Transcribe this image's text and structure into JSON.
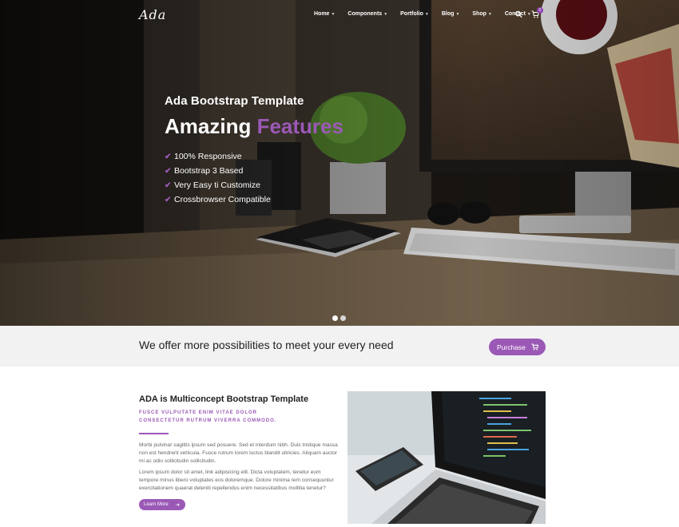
{
  "nav": {
    "logo": "Ada",
    "items": [
      {
        "label": "Home"
      },
      {
        "label": "Components"
      },
      {
        "label": "Portfolio"
      },
      {
        "label": "Blog"
      },
      {
        "label": "Shop"
      },
      {
        "label": "Contact"
      }
    ],
    "cart_count": "0"
  },
  "hero": {
    "subtitle": "Ada Bootstrap Template",
    "title_main": "Amazing",
    "title_accent": "Features",
    "features": [
      "100% Responsive",
      "Bootstrap 3 Based",
      "Very Easy ti Customize",
      "Crossbrowser Compatible"
    ],
    "slide_count": 2,
    "active_slide": 1
  },
  "band": {
    "text": "We offer more possibilities to meet your every need",
    "button_label": "Purchase"
  },
  "content": {
    "title": "ADA is Multiconcept Bootstrap Template",
    "tagline_line1": "FUSCE VULPUTATE ENIM VITAE DOLOR",
    "tagline_line2": "CONSECTETUR RUTRUM VIVERRA COMMODO.",
    "para1": "Morbi pulvinar sagittis ipsum sed posuere. Sed et interdum nibh. Duis tristique massa non est hendrerit vehicula. Fusce rutrum lorem luctus blandit ultricies. Aliquam auctor mi ac odio sollicitudin sollicitudin.",
    "para2": "Lorem ipsum dolor sit amet, link adipisicing elit. Dicta voluptatem, tenetur eum tempore minus libero voluptates eos doloremque. Dolore minima rem consequuntur exercitationem quaerat deleniti repellendus enim necessitatibus mollitia tenetur?",
    "button_label": "Learn More"
  },
  "colors": {
    "accent": "#9b59b6",
    "band_bg": "#f2f2f2",
    "hero_dark": "#1c1916"
  },
  "icons": [
    "search-icon",
    "cart-icon",
    "check-icon",
    "arrow-right-icon",
    "chevron-down-icon"
  ]
}
